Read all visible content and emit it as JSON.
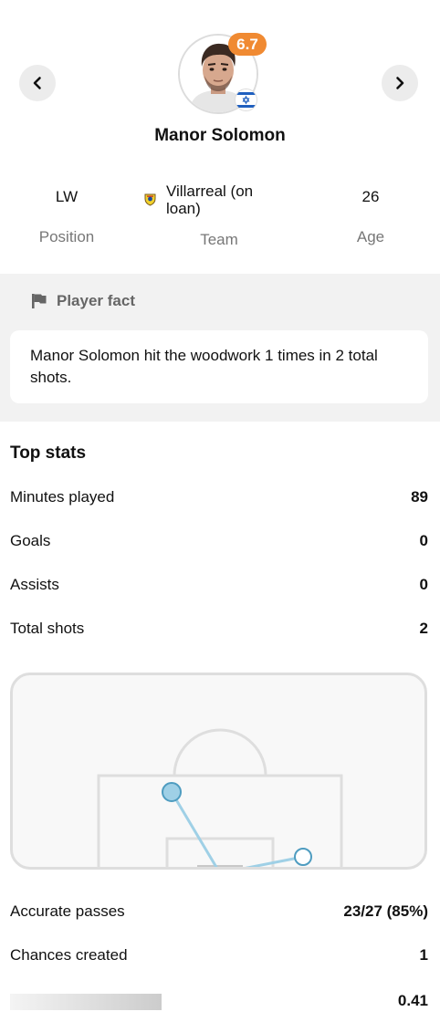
{
  "player": {
    "name": "Manor Solomon",
    "rating": "6.7",
    "country_flag_icon": "israel-flag-icon"
  },
  "info": {
    "position_value": "LW",
    "position_label": "Position",
    "team_value": "Villarreal (on loan)",
    "team_label": "Team",
    "age_value": "26",
    "age_label": "Age"
  },
  "fact": {
    "title": "Player fact",
    "text": "Manor Solomon hit the woodwork 1 times in 2 total shots."
  },
  "top_stats": {
    "title": "Top stats",
    "rows": [
      {
        "label": "Minutes played",
        "value": "89"
      },
      {
        "label": "Goals",
        "value": "0"
      },
      {
        "label": "Assists",
        "value": "0"
      },
      {
        "label": "Total shots",
        "value": "2"
      }
    ]
  },
  "shot_map": {
    "shots": [
      {
        "kind": "filled",
        "color": "#9fd0e6"
      },
      {
        "kind": "open",
        "color": "#9fd0e6"
      }
    ]
  },
  "more_stats": {
    "rows": [
      {
        "label": "Accurate passes",
        "value": "23/27 (85%)"
      },
      {
        "label": "Chances created",
        "value": "1"
      },
      {
        "label": "",
        "value": "0.41"
      }
    ]
  },
  "colors": {
    "rating_badge": "#f08a32",
    "shot": "#9fd0e6",
    "pitch_line": "#dedede"
  }
}
